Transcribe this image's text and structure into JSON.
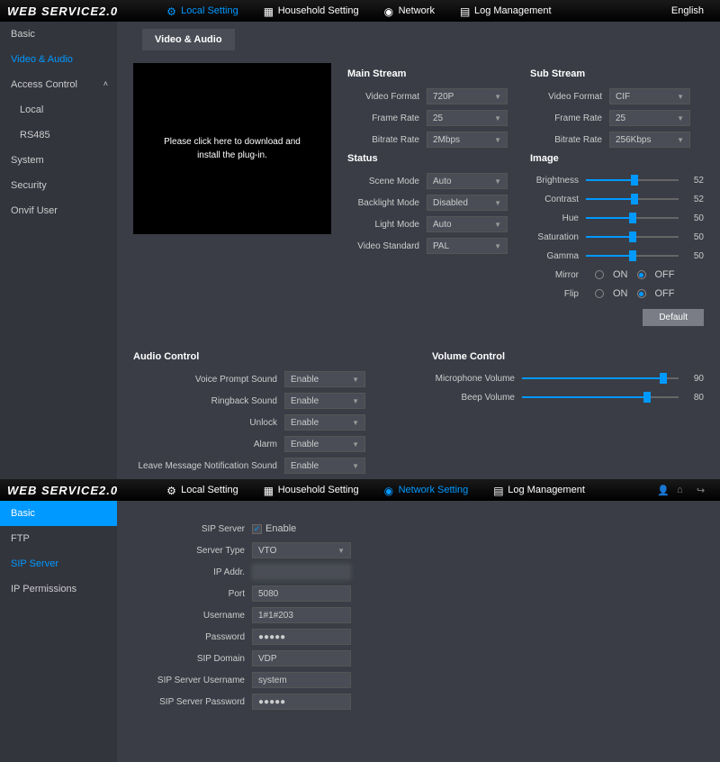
{
  "app": {
    "logo": "WEB SERVICE2.0"
  },
  "top1": {
    "nav": [
      "Local Setting",
      "Household Setting",
      "Network",
      "Log Management"
    ],
    "active": 0,
    "right": "English"
  },
  "side1": {
    "items": [
      "Basic",
      "Video & Audio",
      "Access Control",
      "Local",
      "RS485",
      "System",
      "Security",
      "Onvif User"
    ],
    "active": 1,
    "expanded": 2
  },
  "va": {
    "tab": "Video & Audio",
    "preview": "Please click here to download and install the plug-in.",
    "main_stream": {
      "title": "Main Stream",
      "video_format_label": "Video Format",
      "video_format": "720P",
      "frame_rate_label": "Frame Rate",
      "frame_rate": "25",
      "bitrate_label": "Bitrate Rate",
      "bitrate": "2Mbps"
    },
    "status": {
      "title": "Status",
      "scene_label": "Scene Mode",
      "scene": "Auto",
      "backlight_label": "Backlight Mode",
      "backlight": "Disabled",
      "light_label": "Light Mode",
      "light": "Auto",
      "vstd_label": "Video Standard",
      "vstd": "PAL"
    },
    "sub_stream": {
      "title": "Sub Stream",
      "video_format_label": "Video Format",
      "video_format": "CIF",
      "frame_rate_label": "Frame Rate",
      "frame_rate": "25",
      "bitrate_label": "Bitrate Rate",
      "bitrate": "256Kbps"
    },
    "image": {
      "title": "Image",
      "brightness_label": "Brightness",
      "brightness": 52,
      "contrast_label": "Contrast",
      "contrast": 52,
      "hue_label": "Hue",
      "hue": 50,
      "saturation_label": "Saturation",
      "saturation": 50,
      "gamma_label": "Gamma",
      "gamma": 50,
      "mirror_label": "Mirror",
      "flip_label": "Flip",
      "on": "ON",
      "off": "OFF",
      "mirror": "OFF",
      "flip": "OFF"
    },
    "default_btn": "Default",
    "audio": {
      "title": "Audio Control",
      "voice_label": "Voice Prompt Sound",
      "voice": "Enable",
      "ringback_label": "Ringback Sound",
      "ringback": "Enable",
      "unlock_label": "Unlock",
      "unlock": "Enable",
      "alarm_label": "Alarm",
      "alarm": "Enable",
      "leave_label": "Leave Message Notification Sound",
      "leave": "Enable"
    },
    "volume": {
      "title": "Volume Control",
      "mic_label": "Microphone Volume",
      "mic": 90,
      "beep_label": "Beep Volume",
      "beep": 80
    }
  },
  "top2": {
    "nav": [
      "Local Setting",
      "Household Setting",
      "Network Setting",
      "Log Management"
    ],
    "active": 2
  },
  "side2": {
    "items": [
      "Basic",
      "FTP",
      "SIP Server",
      "IP Permissions"
    ],
    "highlight": 0,
    "active": 2
  },
  "sip": {
    "server_label": "SIP Server",
    "server": "Enable",
    "type_label": "Server Type",
    "type": "VTO",
    "ip_label": "IP Addr.",
    "ip": " ",
    "port_label": "Port",
    "port": "5080",
    "user_label": "Username",
    "user": "1#1#203",
    "pass_label": "Password",
    "pass": "●●●●●",
    "domain_label": "SIP Domain",
    "domain": "VDP",
    "suser_label": "SIP Server Username",
    "suser": "system",
    "spass_label": "SIP Server Password",
    "spass": "●●●●●"
  }
}
